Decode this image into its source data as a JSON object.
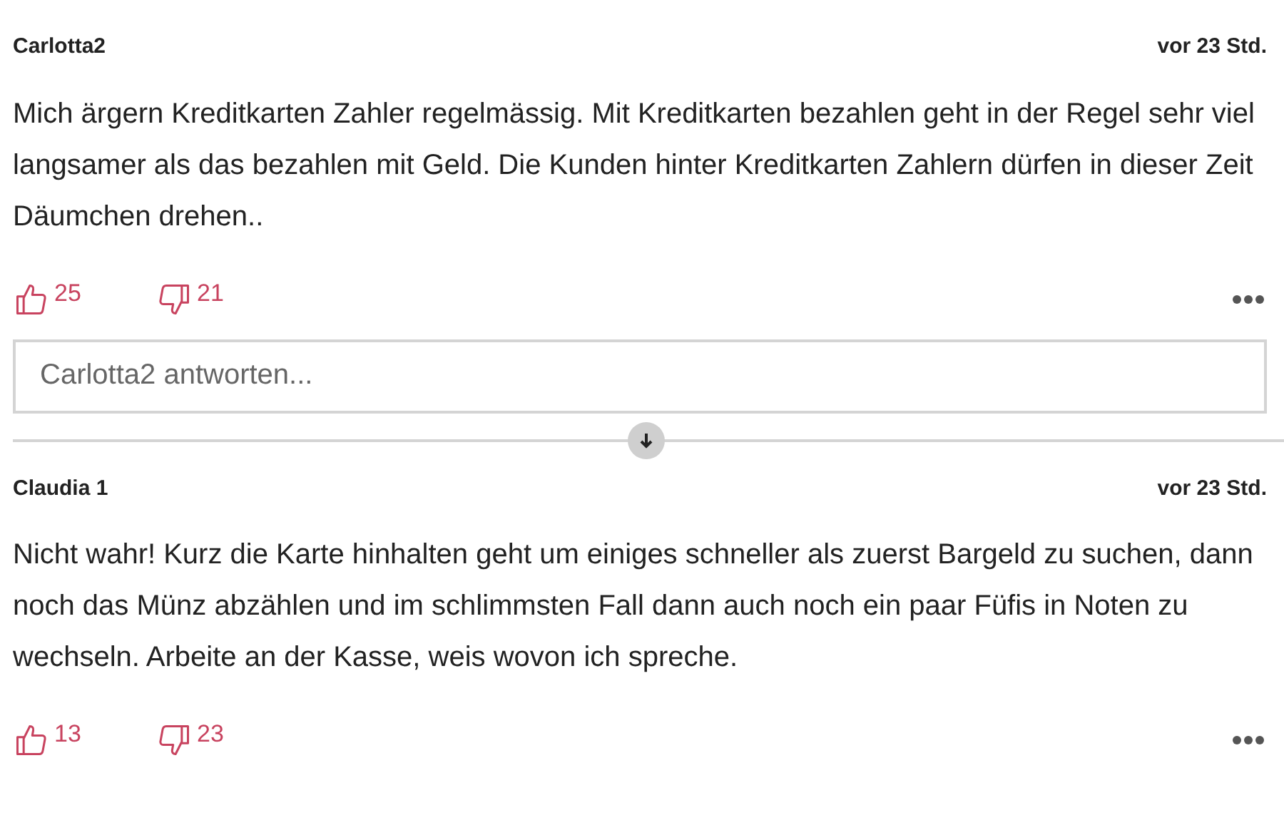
{
  "comments": [
    {
      "author": "Carlotta2",
      "time": "vor 23 Std.",
      "text": "Mich ärgern Kreditkarten Zahler regelmässig. Mit Kreditkarten bezahlen geht in der Regel sehr viel langsamer als das bezahlen mit Geld. Die Kunden hinter Kreditkarten Zahlern dürfen in dieser Zeit Däumchen drehen..",
      "likes": "25",
      "dislikes": "21",
      "reply": {
        "placeholder": "Carlotta2 antworten..."
      }
    },
    {
      "author": "Claudia 1",
      "time": "vor 23 Std.",
      "text": "Nicht wahr! Kurz die Karte hinhalten geht um einiges schneller als zuerst Bargeld zu suchen, dann noch das Münz abzählen und im schlimmsten Fall dann auch noch ein paar Füfis in Noten zu wechseln. Arbeite an der Kasse, weis wovon ich spreche.",
      "likes": "13",
      "dislikes": "23"
    }
  ]
}
